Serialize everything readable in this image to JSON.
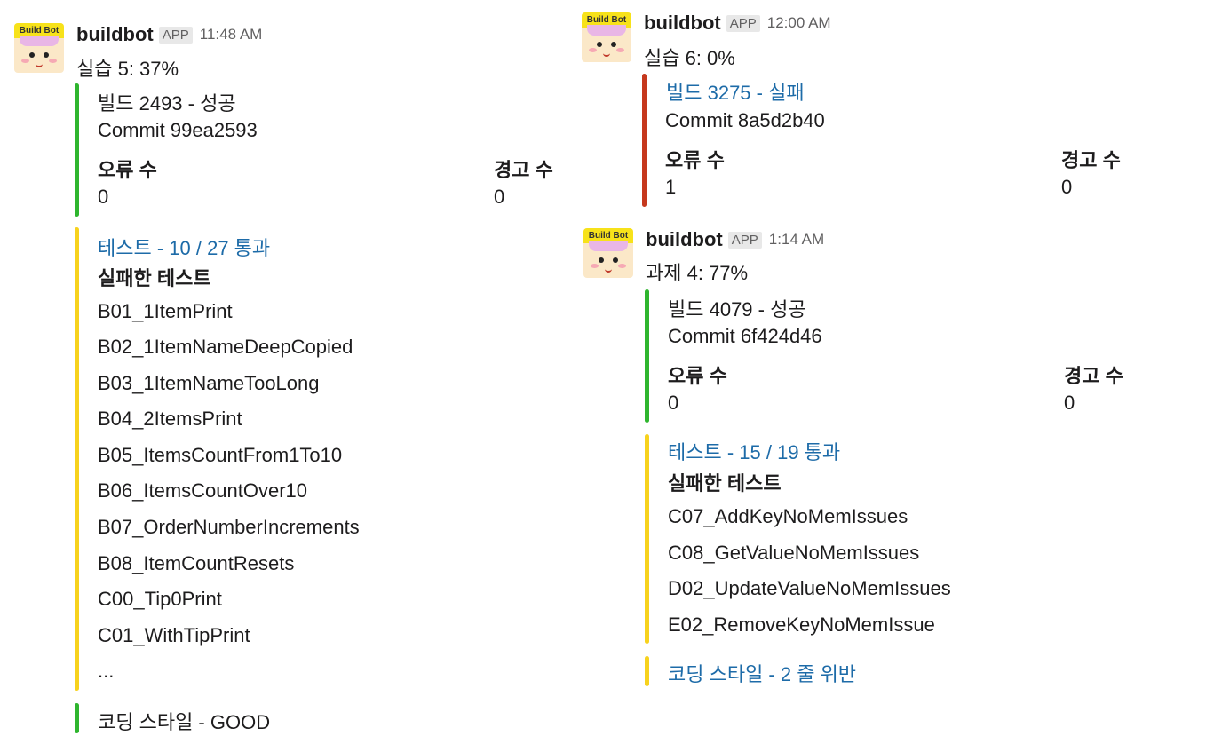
{
  "messages": [
    {
      "bot_name": "buildbot",
      "app_badge": "APP",
      "time": "11:48 AM",
      "summary": "실습 5: 37%",
      "avatar_label": "Build Bot",
      "build": {
        "title": "빌드 2493 - 성공",
        "commit": "Commit 99ea2593",
        "errors_label": "오류 수",
        "errors": "0",
        "warnings_label": "경고 수",
        "warnings": "0",
        "status_color": "#2eb52e"
      },
      "tests": {
        "title": "테스트 - 10 / 27 통과",
        "failed_label": "실패한 테스트",
        "failed": [
          "B01_1ItemPrint",
          "B02_1ItemNameDeepCopied",
          "B03_1ItemNameTooLong",
          "B04_2ItemsPrint",
          "B05_ItemsCountFrom1To10",
          "B06_ItemsCountOver10",
          "B07_OrderNumberIncrements",
          "B08_ItemCountResets",
          "C00_Tip0Print",
          "C01_WithTipPrint",
          "..."
        ]
      },
      "style": {
        "title": "코딩 스타일 - GOOD"
      }
    },
    {
      "bot_name": "buildbot",
      "app_badge": "APP",
      "time": "12:00 AM",
      "summary": "실습 6: 0%",
      "avatar_label": "Build Bot",
      "build": {
        "title": "빌드 3275 - 실패",
        "commit": "Commit 8a5d2b40",
        "errors_label": "오류 수",
        "errors": "1",
        "warnings_label": "경고 수",
        "warnings": "0",
        "status_color": "#c5381d"
      }
    },
    {
      "bot_name": "buildbot",
      "app_badge": "APP",
      "time": "1:14 AM",
      "summary": "과제 4: 77%",
      "avatar_label": "Build Bot",
      "build": {
        "title": "빌드 4079 - 성공",
        "commit": "Commit 6f424d46",
        "errors_label": "오류 수",
        "errors": "0",
        "warnings_label": "경고 수",
        "warnings": "0",
        "status_color": "#2eb52e"
      },
      "tests": {
        "title": "테스트 - 15 / 19 통과",
        "failed_label": "실패한 테스트",
        "failed": [
          "C07_AddKeyNoMemIssues",
          "C08_GetValueNoMemIssues",
          "D02_UpdateValueNoMemIssues",
          "E02_RemoveKeyNoMemIssue"
        ]
      },
      "style": {
        "title": "코딩 스타일 - 2 줄 위반"
      }
    }
  ]
}
